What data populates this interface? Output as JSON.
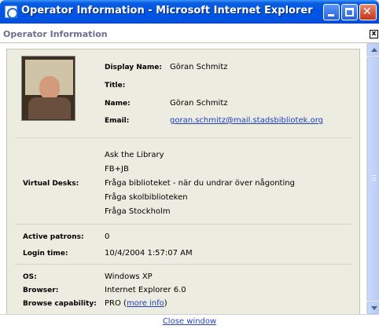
{
  "window": {
    "title": "Operator Information - Microsoft Internet Explorer",
    "minimize_glyph": "_",
    "maximize_glyph": "□",
    "close_glyph": "✕"
  },
  "header": {
    "title": "Operator Information",
    "close_glyph": "x"
  },
  "operator": {
    "display_name_label": "Display Name:",
    "display_name": "Göran Schmitz",
    "title_label": "Title:",
    "title_value": "",
    "name_label": "Name:",
    "name": "Göran Schmitz",
    "email_label": "Email:",
    "email": "goran.schmitz@mail.stadsbibliotek.org"
  },
  "virtual_desks": {
    "label": "Virtual Desks:",
    "items": [
      "Ask the Library",
      "FB+JB",
      "Fråga biblioteket - när du undrar över någonting",
      "Fråga skolbiblioteken",
      "Fråga Stockholm"
    ]
  },
  "session": {
    "active_patrons_label": "Active patrons:",
    "active_patrons": "0",
    "login_time_label": "Login time:",
    "login_time": "10/4/2004 1:57:07 AM"
  },
  "system": {
    "os_label": "OS:",
    "os": "Windows XP",
    "browser_label": "Browser:",
    "browser": "Internet Explorer 6.0",
    "capability_label": "Browse capability:",
    "capability": "PRO (",
    "more_info": "more info",
    "capability_suffix": ")"
  },
  "footer": {
    "close_window": "Close window"
  },
  "icons": {
    "window": "ie-icon",
    "photo": "operator-photo"
  }
}
